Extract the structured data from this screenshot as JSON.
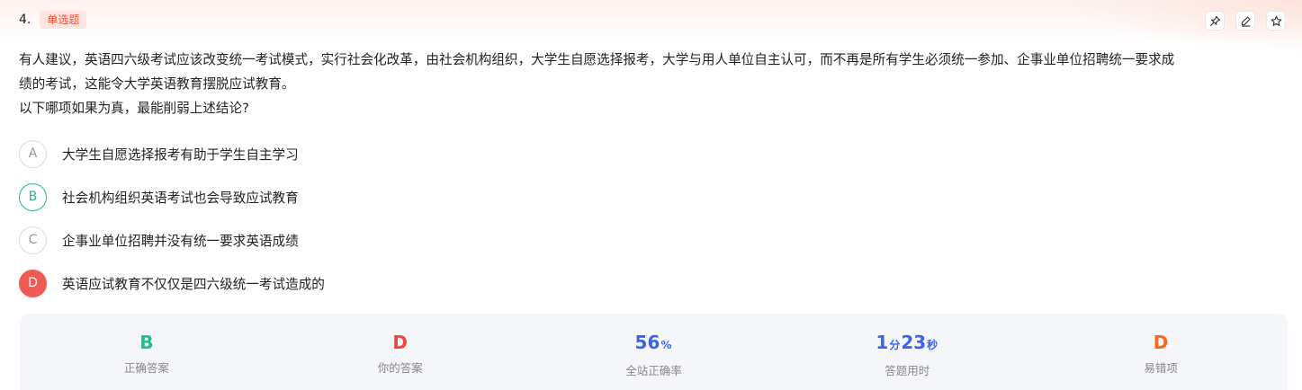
{
  "question": {
    "number": "4.",
    "type_badge": "单选题",
    "stem_line1": "有人建议，英语四六级考试应该改变统一考试模式，实行社会化改革，由社会机构组织，大学生自愿选择报考，大学与用人单位自主认可，而不再是所有学生必须统一参加、企事业单位招聘统一要求成",
    "stem_line2": "绩的考试，这能令大学英语教育摆脱应试教育。",
    "prompt": "以下哪项如果为真，最能削弱上述结论?"
  },
  "actions": {
    "pin_icon": "pin-icon",
    "note_icon": "edit-icon",
    "favorite_icon": "star-icon"
  },
  "options": [
    {
      "letter": "A",
      "text": "大学生自愿选择报考有助于学生自主学习",
      "state": "default"
    },
    {
      "letter": "B",
      "text": "社会机构组织英语考试也会导致应试教育",
      "state": "correct"
    },
    {
      "letter": "C",
      "text": "企事业单位招聘并没有统一要求英语成绩",
      "state": "default"
    },
    {
      "letter": "D",
      "text": "英语应试教育不仅仅是四六级统一考试造成的",
      "state": "chosen"
    }
  ],
  "stats": {
    "correct_answer": {
      "value": "B",
      "label": "正确答案"
    },
    "your_answer": {
      "value": "D",
      "label": "你的答案"
    },
    "accuracy": {
      "value": "56",
      "unit": "%",
      "label": "全站正确率"
    },
    "time": {
      "minutes": "1",
      "min_unit": "分",
      "seconds": "23",
      "sec_unit": "秒",
      "label": "答题用时"
    },
    "common_mistake": {
      "value": "D",
      "label": "易错项"
    }
  },
  "colors": {
    "badge_red": "#f2543d",
    "correct_green": "#1fbf86",
    "wrong_red": "#f2473d",
    "stat_blue": "#3b64e6",
    "mistake_orange": "#fa6a1e",
    "stats_bg": "#f5f6fa"
  }
}
